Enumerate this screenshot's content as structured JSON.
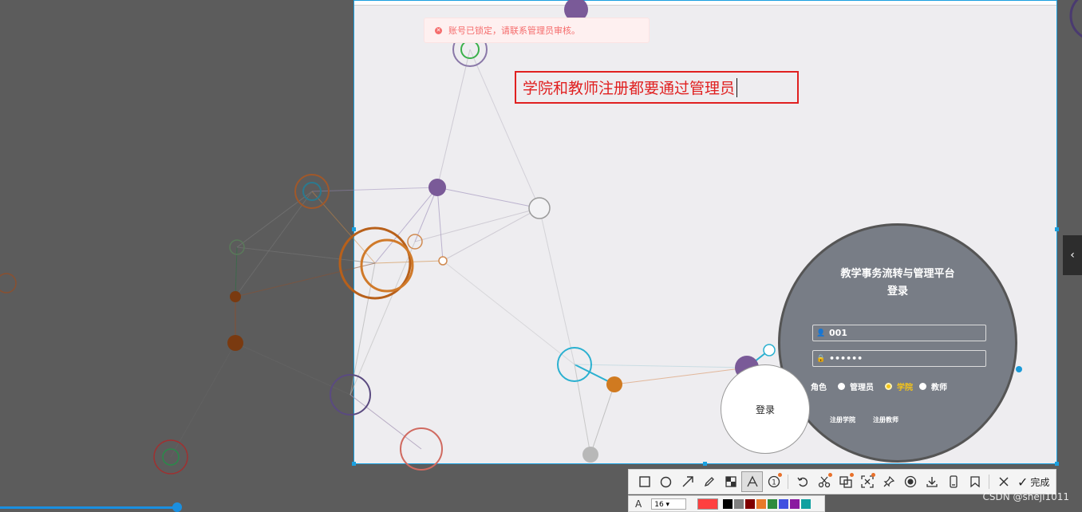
{
  "toast": {
    "message": "账号已锁定，请联系管理员审核。"
  },
  "annotation": {
    "text": "学院和教师注册都要通过管理员"
  },
  "login": {
    "title_line1": "教学事务流转与管理平台",
    "title_line2": "登录",
    "username": "001",
    "password_mask": "••••••",
    "role_label": "角色",
    "roles": [
      {
        "label": "管理员",
        "selected": false
      },
      {
        "label": "学院",
        "selected": true
      },
      {
        "label": "教师",
        "selected": false
      }
    ],
    "register_college": "注册学院",
    "register_teacher": "注册教师",
    "login_button": "登录"
  },
  "toolbar": {
    "tools": [
      "rectangle-icon",
      "ellipse-icon",
      "arrow-icon",
      "pencil-icon",
      "mosaic-icon",
      "text-icon",
      "number-icon",
      "undo-icon",
      "scissors-icon",
      "ocr-icon",
      "scan-icon",
      "pin-icon",
      "record-icon",
      "download-icon",
      "phone-icon",
      "bookmark-icon",
      "close-icon"
    ],
    "done_label": "完成",
    "font_size": "16",
    "swatch_colors": [
      "#000000",
      "#808080",
      "#800000",
      "#e87a2a",
      "#2e8b3e",
      "#4050e0",
      "#8a1aa0",
      "#10a0a0"
    ],
    "current_color": "#ff4040"
  },
  "watermark": "CSDN @sheji1011",
  "colors": {
    "accent": "#1aa0e0",
    "annotation": "#e02020",
    "error": "#f56c6c"
  }
}
